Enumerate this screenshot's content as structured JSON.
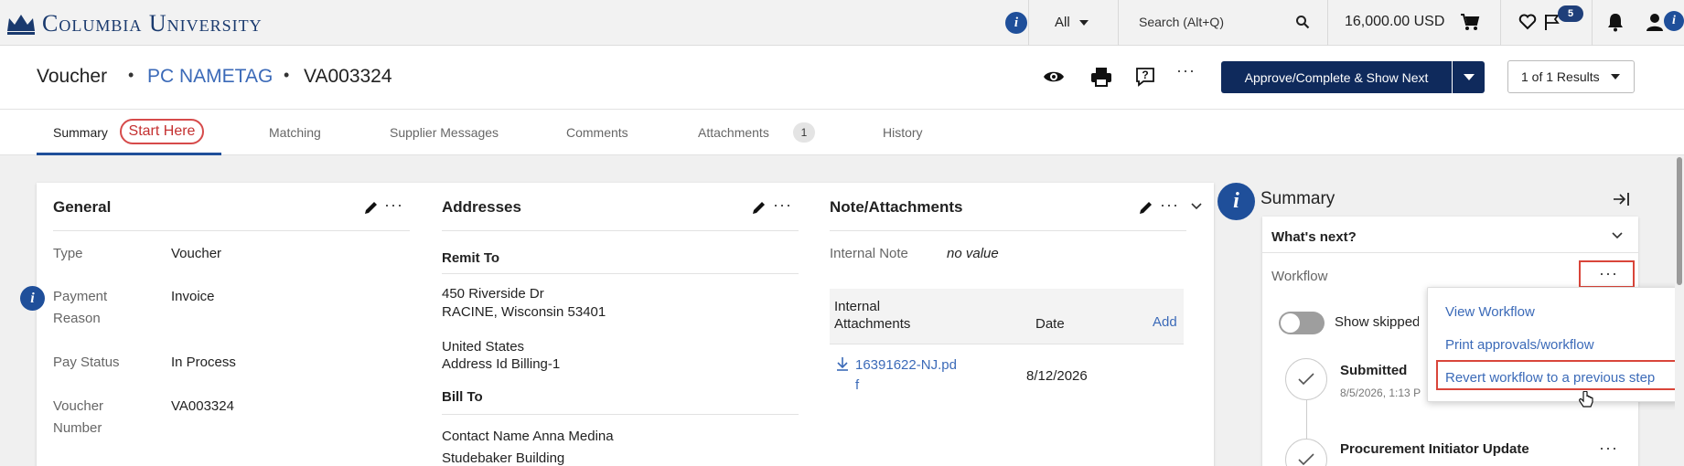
{
  "topbar": {
    "logo_text": "Columbia University",
    "search_scope": "All",
    "search_placeholder": "Search (Alt+Q)",
    "cart_total": "16,000.00 USD",
    "flag_badge": "5"
  },
  "header": {
    "doc_type": "Voucher",
    "supplier": "PC NAMETAG",
    "doc_number": "VA003324",
    "approve_label": "Approve/Complete & Show Next",
    "results_label": "1 of 1 Results"
  },
  "tabs": [
    {
      "label": "Summary"
    },
    {
      "label": "Matching"
    },
    {
      "label": "Supplier Messages"
    },
    {
      "label": "Comments"
    },
    {
      "label": "Attachments",
      "badge": "1"
    },
    {
      "label": "History"
    }
  ],
  "start_here": "Start Here",
  "general": {
    "title": "General",
    "rows": [
      {
        "label": "Type",
        "value": "Voucher"
      },
      {
        "label_1": "Payment",
        "label_2": "Reason",
        "value": "Invoice"
      },
      {
        "label": "Pay Status",
        "value": "In Process"
      },
      {
        "label_1": "Voucher",
        "label_2": "Number",
        "value": "VA003324"
      }
    ]
  },
  "addresses": {
    "title": "Addresses",
    "remit_to_label": "Remit To",
    "remit_line1": "450 Riverside Dr",
    "remit_line2": "RACINE, Wisconsin 53401",
    "remit_line3": "United States",
    "remit_line4": "Address Id Billing-1",
    "bill_to_label": "Bill To",
    "bill_line1": "Contact Name Anna Medina",
    "bill_line2": "Studebaker Building"
  },
  "notes": {
    "title": "Note/Attachments",
    "internal_note_label": "Internal Note",
    "internal_note_value": "no value",
    "attach_col1_a": "Internal",
    "attach_col1_b": "Attachments",
    "attach_col2": "Date",
    "add_label": "Add",
    "file_name_a": "16391622-NJ.pd",
    "file_name_b": "f",
    "file_date": "8/12/2026"
  },
  "summary_panel": {
    "title": "Summary",
    "whats_next": "What's next?",
    "workflow_label": "Workflow",
    "show_skipped": "Show skipped s",
    "step1_title": "Submitted",
    "step1_time": "8/5/2026, 1:13 P",
    "step2_title": "Procurement Initiator Update"
  },
  "workflow_menu": {
    "items": [
      "View Workflow",
      "Print approvals/workflow",
      "Revert workflow to a previous step"
    ]
  },
  "colors": {
    "brand_navy": "#0f2a5c",
    "link_blue": "#3b6ab8",
    "highlight_red": "#d9453a"
  }
}
